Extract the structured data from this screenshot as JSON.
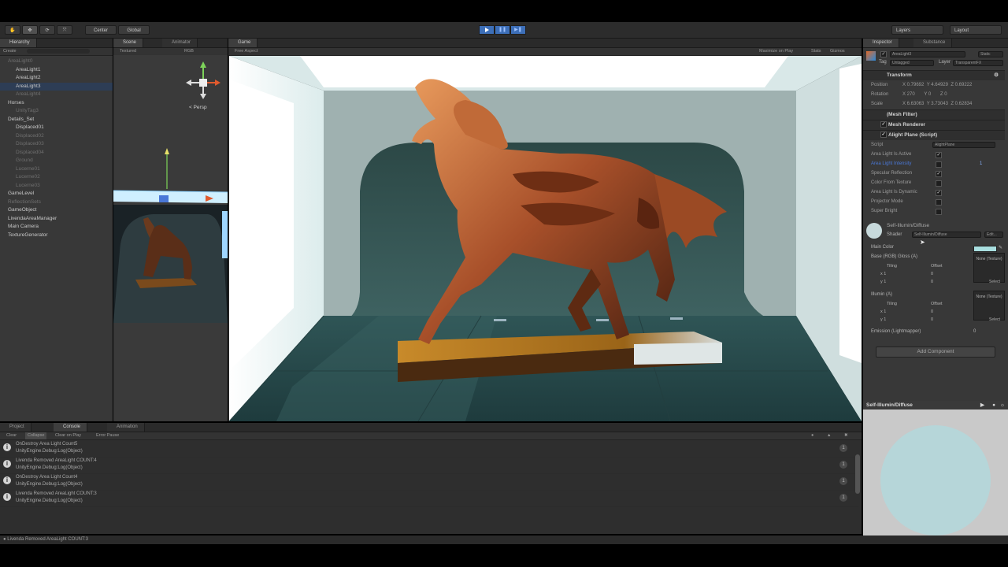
{
  "toolbar": {
    "pivot_label": "Center",
    "space_label": "Global",
    "layers_label": "Layers",
    "layout_label": "Layout"
  },
  "hierarchy": {
    "tab_label": "Hierarchy",
    "create_label": "Create",
    "items": [
      {
        "label": "AreaLight0",
        "indent": 0,
        "dim": true
      },
      {
        "label": "AreaLight1",
        "indent": 1,
        "dim": false
      },
      {
        "label": "AreaLight2",
        "indent": 1,
        "dim": false
      },
      {
        "label": "AreaLight3",
        "indent": 1,
        "dim": false,
        "selected": true
      },
      {
        "label": "AreaLight4",
        "indent": 1,
        "dim": true
      },
      {
        "label": "Horses",
        "indent": 0,
        "dim": false
      },
      {
        "label": "UnityTag3",
        "indent": 1,
        "dim": true
      },
      {
        "label": "Details_Set",
        "indent": 0,
        "dim": false
      },
      {
        "label": "Displaced01",
        "indent": 1,
        "dim": false
      },
      {
        "label": "Displaced02",
        "indent": 1,
        "dim": true
      },
      {
        "label": "Displaced03",
        "indent": 1,
        "dim": true
      },
      {
        "label": "Displaced04",
        "indent": 1,
        "dim": true
      },
      {
        "label": "Ground",
        "indent": 1,
        "dim": true
      },
      {
        "label": "Lucerne01",
        "indent": 1,
        "dim": true
      },
      {
        "label": "Lucerne02",
        "indent": 1,
        "dim": true
      },
      {
        "label": "Lucerne03",
        "indent": 1,
        "dim": true
      },
      {
        "label": "GameLevel",
        "indent": 0,
        "dim": false
      },
      {
        "label": "ReflectionSets",
        "indent": 0,
        "dim": true
      },
      {
        "label": "GameObject",
        "indent": 0,
        "dim": false
      },
      {
        "label": "LivendaAreaManager",
        "indent": 0,
        "dim": false
      },
      {
        "label": "Main Camera",
        "indent": 0,
        "dim": false
      },
      {
        "label": "TextureGenerator",
        "indent": 0,
        "dim": false
      }
    ]
  },
  "scene": {
    "tab_label": "Scene",
    "animator_tab_label": "Animator",
    "shading_label": "Textured",
    "render_label": "RGB",
    "persp_label": "< Persp"
  },
  "game": {
    "tab_label": "Game",
    "aspect_label": "Free Aspect",
    "maximize_label": "Maximize on Play",
    "stats_label": "Stats",
    "gizmos_label": "Gizmos"
  },
  "inspector": {
    "tab_label": "Inspector",
    "second_tab_label": "Substance",
    "object_name": "AreaLight3",
    "static_label": "Static",
    "tag_label": "Tag",
    "tag_value": "Untagged",
    "layer_label": "Layer",
    "layer_value": "TransparentFX",
    "transform_label": "Transform",
    "position_label": "Position",
    "position": {
      "x": "0.79692",
      "y": "4.64929",
      "z": "0.69222"
    },
    "rotation_label": "Rotation",
    "rotation": {
      "x": "270",
      "y": "0",
      "z": "0"
    },
    "scale_label": "Scale",
    "scale": {
      "x": "6.63063",
      "y": "3.73043",
      "z": "0.62834"
    },
    "mesh_filter_label": "(Mesh Filter)",
    "mesh_renderer_label": "Mesh Renderer",
    "script_component_label": "Alight Plane (Script)",
    "script_label": "Script",
    "script_value": "AlightPlane",
    "props": [
      {
        "label": "Area Light Is Active",
        "checked": true,
        "highlight": false
      },
      {
        "label": "Area Light Intensity",
        "checked": false,
        "highlight": true
      },
      {
        "label": "Specular Reflection",
        "checked": true,
        "highlight": false
      },
      {
        "label": "Color From Texture",
        "checked": false,
        "highlight": false
      },
      {
        "label": "Area Light Is Dynamic",
        "checked": true,
        "highlight": false
      },
      {
        "label": "Projector Mode",
        "checked": false,
        "highlight": false
      },
      {
        "label": "Super Bright",
        "checked": false,
        "highlight": false
      }
    ],
    "intensity_value": "1",
    "material_name": "Self-Illumin/Diffuse",
    "shader_label": "Shader",
    "shader_value": "Self-Illumin/Diffuse",
    "edit_label": "Edit...",
    "main_color_label": "Main Color",
    "base_label": "Base (RGB) Gloss (A)",
    "tiling_label": "Tiling",
    "offset_label": "Offset",
    "x_label": "x",
    "y_label": "y",
    "tile_val": "1",
    "offset_val": "0",
    "none_texture": "None (Texture)",
    "select_label": "Select",
    "illumin_label": "Illumin (A)",
    "emission_label": "Emission (Lightmapper)",
    "emission_value": "0",
    "add_component_label": "Add Component"
  },
  "preview": {
    "title": "Self-Illumin/Diffuse",
    "sphere_color": "#b6d6d9"
  },
  "bottom": {
    "project_tab_label": "Project",
    "console_tab_label": "Console",
    "animation_tab_label": "Animation",
    "clear_label": "Clear",
    "collapse_label": "Collapse",
    "clear_on_play_label": "Clear on Play",
    "error_pause_label": "Error Pause",
    "logs": [
      {
        "line1": "OnDestroy Area Light Count5",
        "line2": "UnityEngine.Debug:Log(Object)",
        "count": "1"
      },
      {
        "line1": "Livenda Removed AreaLight COUNT:4",
        "line2": "UnityEngine.Debug:Log(Object)",
        "count": "1"
      },
      {
        "line1": "OnDestroy Area Light Count4",
        "line2": "UnityEngine.Debug:Log(Object)",
        "count": "1"
      },
      {
        "line1": "Livenda Removed AreaLight COUNT:3",
        "line2": "UnityEngine.Debug:Log(Object)",
        "count": "1"
      }
    ],
    "status_text": "Livenda Removed AreaLight COUNT:3"
  },
  "colors": {
    "selection": "#2d3d55",
    "play_active": "#3d6fb8",
    "preview_bg": "#c9c9c9"
  }
}
